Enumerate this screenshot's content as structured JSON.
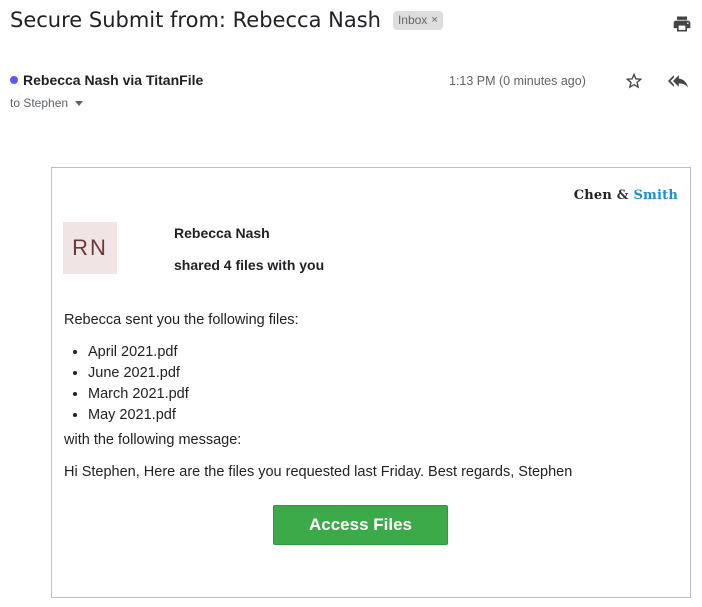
{
  "header": {
    "subject": "Secure Submit from: Rebecca Nash",
    "label": "Inbox",
    "label_remove": "×",
    "print_icon": "printer-icon"
  },
  "message": {
    "sender": "Rebecca Nash via TitanFile",
    "recipient": "to Stephen",
    "time": "1:13 PM (0 minutes ago)",
    "star_icon": "star-outline-icon",
    "reply_all_icon": "reply-all-icon",
    "unread_dot_color": "#5b5bf5"
  },
  "email_body": {
    "brand": {
      "part1": "Chen",
      "amp": "&",
      "part2": "Smith",
      "accent_color": "#1a8fd6"
    },
    "avatar_initials": "RN",
    "sharer_name": "Rebecca Nash",
    "shared_text": "shared 4 files with you",
    "intro": "Rebecca sent you the following files:",
    "files": [
      "April 2021.pdf",
      "June 2021.pdf",
      "March 2021.pdf",
      "May 2021.pdf"
    ],
    "message_label": "with the following message:",
    "message_text": "Hi Stephen, Here are the files you requested last Friday. Best regards, Stephen",
    "button_label": "Access Files",
    "button_color": "#3daa4a"
  }
}
